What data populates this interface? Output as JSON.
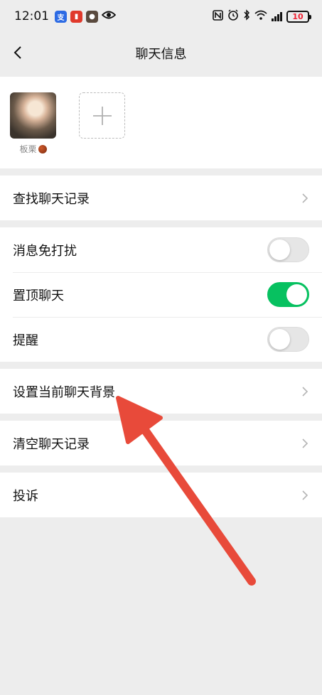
{
  "status_bar": {
    "time": "12:01",
    "battery_level": "10"
  },
  "navbar": {
    "title": "聊天信息"
  },
  "members": [
    {
      "name": "板栗"
    }
  ],
  "rows": {
    "search_history": "查找聊天记录",
    "mute": "消息免打扰",
    "pin": "置顶聊天",
    "remind": "提醒",
    "set_background": "设置当前聊天背景",
    "clear_history": "清空聊天记录",
    "report": "投诉"
  },
  "toggles": {
    "mute": false,
    "pin": true,
    "remind": false
  },
  "colors": {
    "accent_green": "#07c160",
    "annotation_arrow": "#e84a3a",
    "background": "#ededed"
  }
}
